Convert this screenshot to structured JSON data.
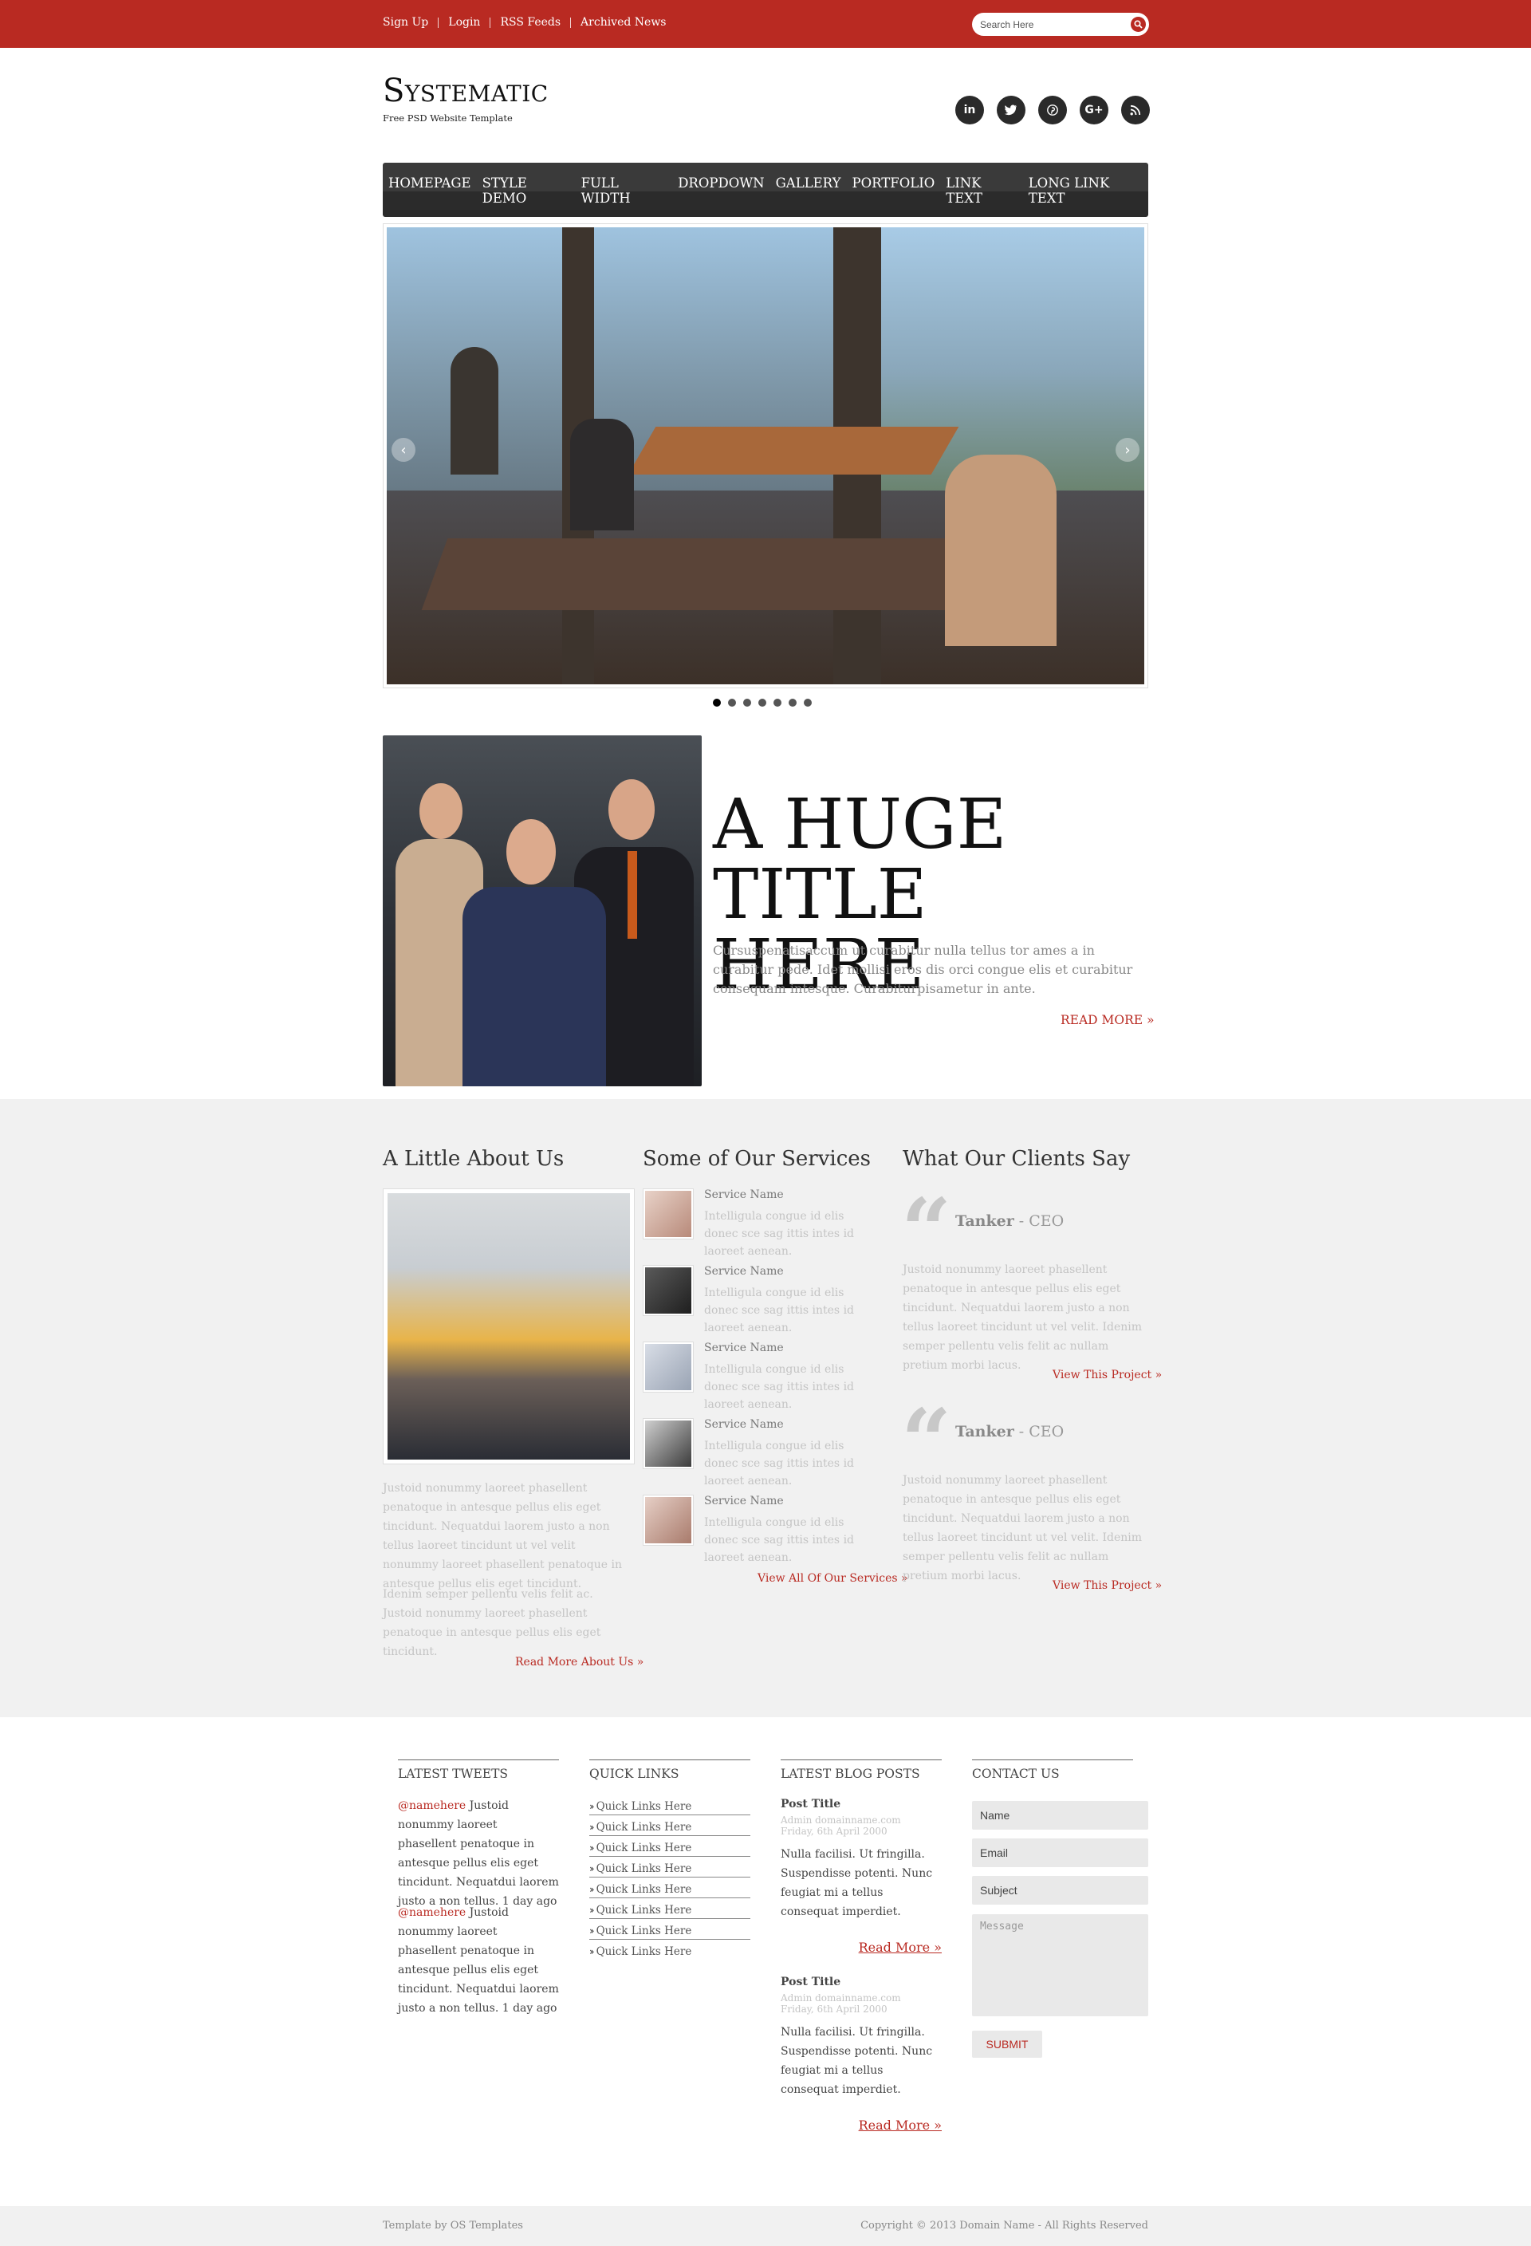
{
  "topbar": {
    "links": [
      "Sign Up",
      "Login",
      "RSS Feeds",
      "Archived News"
    ],
    "search_placeholder": "Search Here"
  },
  "header": {
    "logo": "Systematic",
    "tagline": "Free PSD Website Template",
    "social": [
      {
        "icon": "linkedin-icon",
        "glyph": "in"
      },
      {
        "icon": "twitter-icon",
        "glyph": "t"
      },
      {
        "icon": "pinterest-icon",
        "glyph": "P"
      },
      {
        "icon": "google-plus-icon",
        "glyph": "G+"
      },
      {
        "icon": "rss-icon",
        "glyph": "≋"
      }
    ]
  },
  "nav": [
    "Homepage",
    "Style Demo",
    "Full Width",
    "Dropdown",
    "Gallery",
    "Portfolio",
    "Link Text",
    "Long Link Text"
  ],
  "slider": {
    "prev": "‹",
    "next": "›",
    "slide_count": 7,
    "active_slide": 1
  },
  "feature": {
    "title": "A Huge Title Here",
    "text": "Cursuspenatisaccum ut curabitur nulla tellus tor ames a in curabitur pede. Idet mollisi eros dis orci congue elis et curabitur consequam intesque. Curabiturpisametur in ante.",
    "read_more": "READ MORE »"
  },
  "about": {
    "heading": "A Little About Us",
    "p1": "Justoid nonummy laoreet phasellent penatoque in antesque pellus elis eget tincidunt. Nequatdui laorem justo a non tellus laoreet tincidunt ut vel velit nonummy laoreet phasellent penatoque in antesque pellus elis eget tincidunt.",
    "p2": "Idenim semper pellentu velis felit ac. Justoid nonummy laoreet phasellent penatoque in antesque pellus elis eget tincidunt.",
    "link": "Read More About Us »"
  },
  "services": {
    "heading": "Some of Our Services",
    "items": [
      {
        "name": "Service Name",
        "desc": "Intelligula congue id elis donec sce sag ittis intes id laoreet aenean."
      },
      {
        "name": "Service Name",
        "desc": "Intelligula congue id elis donec sce sag ittis intes id laoreet aenean."
      },
      {
        "name": "Service Name",
        "desc": "Intelligula congue id elis donec sce sag ittis intes id laoreet aenean."
      },
      {
        "name": "Service Name",
        "desc": "Intelligula congue id elis donec sce sag ittis intes id laoreet aenean."
      },
      {
        "name": "Service Name",
        "desc": "Intelligula congue id elis donec sce sag ittis intes id laoreet aenean."
      }
    ],
    "link": "View All Of Our Services »"
  },
  "clients": {
    "heading": "What Our Clients Say",
    "items": [
      {
        "name": "Tanker",
        "role": " - CEO",
        "text": "Justoid nonummy laoreet phasellent penatoque in antesque pellus elis eget tincidunt. Nequatdui laorem justo a non tellus laoreet tincidunt ut vel velit. Idenim semper pellentu velis felit ac nullam pretium morbi lacus.",
        "link": "View This Project »"
      },
      {
        "name": "Tanker",
        "role": " - CEO",
        "text": "Justoid nonummy laoreet phasellent penatoque in antesque pellus elis eget tincidunt. Nequatdui laorem justo a non tellus laoreet tincidunt ut vel velit. Idenim semper pellentu velis felit ac nullam pretium morbi lacus.",
        "link": "View This Project »"
      }
    ]
  },
  "footer": {
    "tweets_title": "Latest Tweets",
    "tweets": [
      {
        "handle": "@namehere",
        "text": " Justoid nonummy laoreet phasellent penatoque in antesque pellus elis eget tincidunt. Nequatdui laorem justo a non tellus. 1 day ago"
      },
      {
        "handle": "@namehere",
        "text": " Justoid nonummy laoreet phasellent penatoque in antesque pellus elis eget tincidunt. Nequatdui laorem justo a non tellus. 1 day ago"
      }
    ],
    "quick_title": "Quick Links",
    "quick_links": [
      "Quick Links Here",
      "Quick Links Here",
      "Quick Links Here",
      "Quick Links Here",
      "Quick Links Here",
      "Quick Links Here",
      "Quick Links Here",
      "Quick Links Here"
    ],
    "blog_title": "Latest Blog Posts",
    "posts": [
      {
        "title": "Post Title",
        "author": "Admin domainname.com",
        "date": "Friday, 6th April 2000",
        "body": "Nulla facilisi. Ut fringilla. Suspendisse potenti. Nunc feugiat mi a tellus consequat imperdiet.",
        "more": "Read More »"
      },
      {
        "title": "Post Title",
        "author": "Admin domainname.com",
        "date": "Friday, 6th April 2000",
        "body": "Nulla facilisi. Ut fringilla. Suspendisse potenti. Nunc feugiat mi a tellus consequat imperdiet.",
        "more": "Read More »"
      }
    ],
    "contact_title": "Contact Us",
    "contact": {
      "name": "Name",
      "email": "Email",
      "subject": "Subject",
      "message": "Message",
      "submit": "SUBMIT"
    }
  },
  "bottom": {
    "left": "Template by OS Templates",
    "right": "Copyright © 2013 Domain Name - All Rights Reserved"
  },
  "colors": {
    "accent": "#b92a22",
    "nav_bg": "#2b2b2b",
    "section_gray": "#f1f1f1"
  }
}
